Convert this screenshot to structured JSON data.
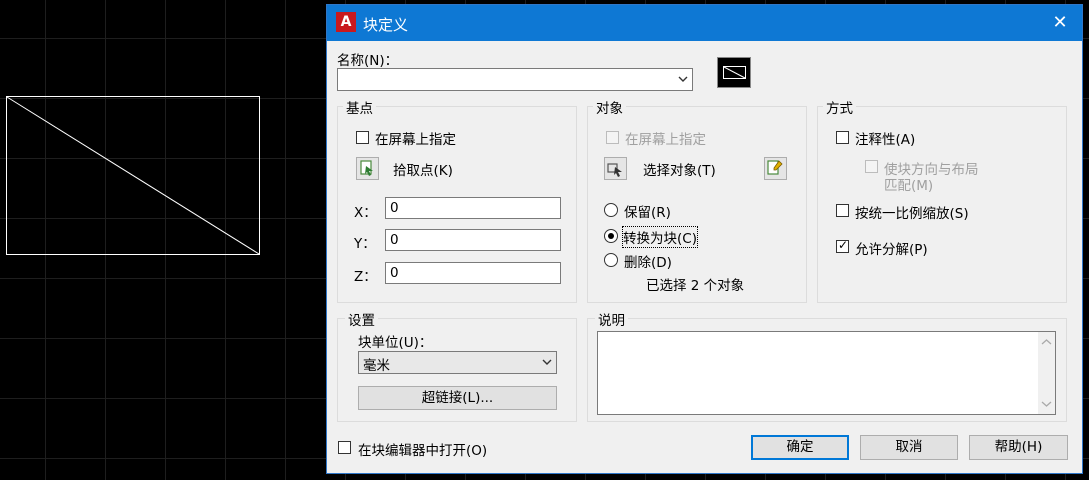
{
  "dialog": {
    "title": "块定义",
    "logo_letter": "A",
    "close_glyph": "✕"
  },
  "name_section": {
    "label": "名称(N)：",
    "value": ""
  },
  "base_point": {
    "title": "基点",
    "specify_on_screen": {
      "label": "在屏幕上指定",
      "checked": false
    },
    "pick_point_label": "拾取点(K)",
    "x_label": "X：",
    "x_value": "0",
    "y_label": "Y：",
    "y_value": "0",
    "z_label": "Z：",
    "z_value": "0"
  },
  "objects": {
    "title": "对象",
    "specify_on_screen": {
      "label": "在屏幕上指定",
      "checked": false,
      "enabled": false
    },
    "select_objects_label": "选择对象(T)",
    "retain_label": "保留(R)",
    "convert_label": "转换为块(C)",
    "delete_label": "删除(D)",
    "selected_option": "convert",
    "selection_status": "已选择 2 个对象"
  },
  "behavior": {
    "title": "方式",
    "annotative": {
      "label": "注释性(A)",
      "checked": false
    },
    "match_orientation": {
      "label_line1": "使块方向与布局",
      "label_line2": "匹配(M)",
      "checked": false,
      "enabled": false
    },
    "scale_uniformly": {
      "label": "按统一比例缩放(S)",
      "checked": false
    },
    "allow_exploding": {
      "label": "允许分解(P)",
      "checked": true
    }
  },
  "settings": {
    "title": "设置",
    "block_unit_label": "块单位(U)：",
    "block_unit_value": "毫米",
    "hyperlink_label": "超链接(L)..."
  },
  "description": {
    "title": "说明",
    "value": ""
  },
  "footer": {
    "open_in_editor": {
      "label": "在块编辑器中打开(O)",
      "checked": false
    },
    "ok_label": "确定",
    "cancel_label": "取消",
    "help_label": "帮助(H)"
  },
  "colors": {
    "titlebar": "#0e78d4",
    "dialog_bg": "#f0f0f0",
    "canvas_bg": "#000000",
    "drawing_stroke": "#ffffff",
    "logo": "#c9191e"
  }
}
